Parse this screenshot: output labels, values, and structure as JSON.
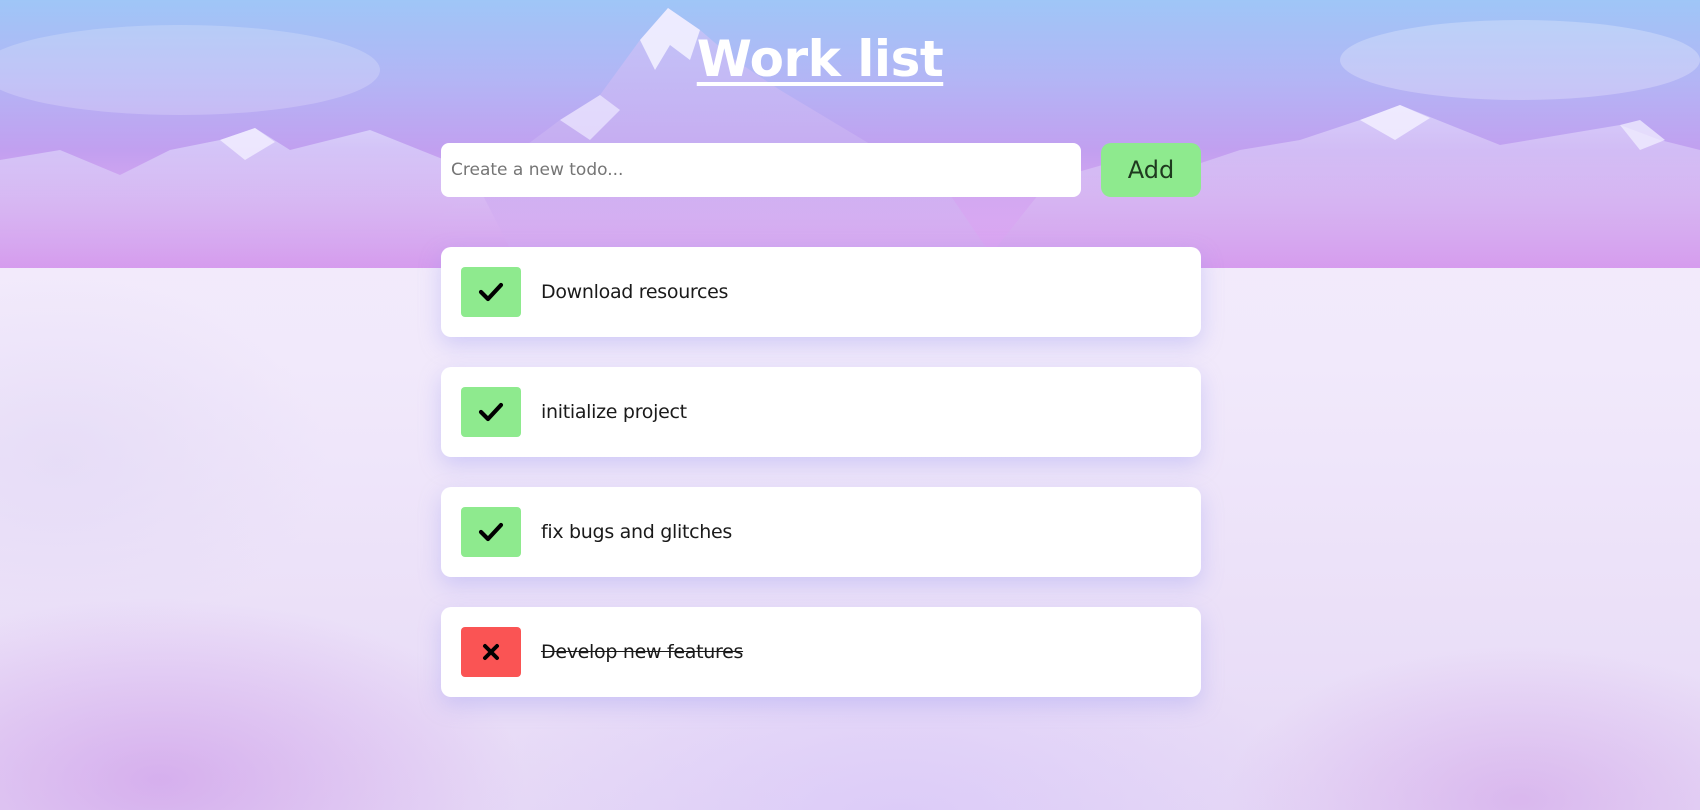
{
  "app": {
    "title": "Work list"
  },
  "new_todo": {
    "placeholder": "Create a new todo...",
    "value": "",
    "add_label": "Add"
  },
  "todos": [
    {
      "text": "Download resources",
      "state": "done",
      "icon": "check-icon"
    },
    {
      "text": "initialize project",
      "state": "done",
      "icon": "check-icon"
    },
    {
      "text": "fix bugs and glitches",
      "state": "done",
      "icon": "check-icon"
    },
    {
      "text": "Develop new features",
      "state": "struck",
      "icon": "close-icon"
    }
  ],
  "colors": {
    "accent_green": "#8eea8e",
    "accent_red": "#fa5454",
    "banner_top": "#9fc6f7",
    "banner_bottom": "#d394ee"
  }
}
